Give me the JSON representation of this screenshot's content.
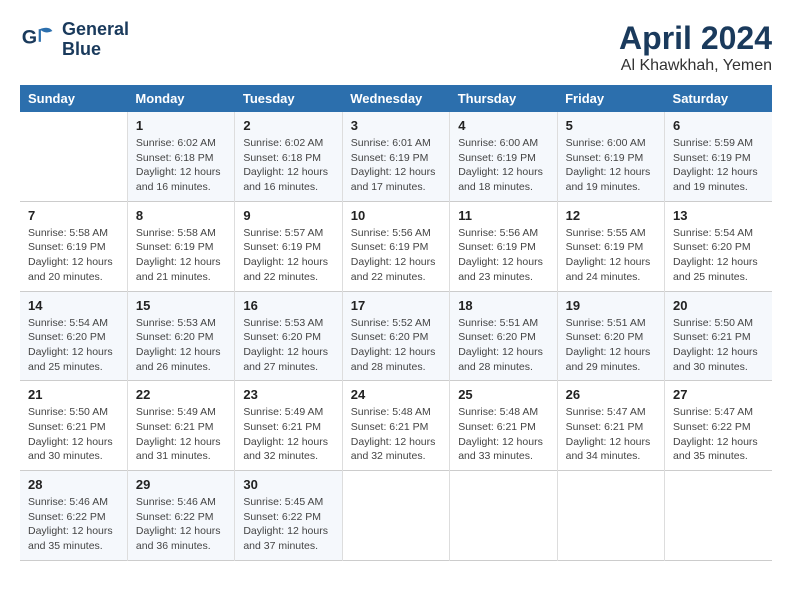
{
  "header": {
    "logo_line1": "General",
    "logo_line2": "Blue",
    "title": "April 2024",
    "subtitle": "Al Khawkhah, Yemen"
  },
  "columns": [
    "Sunday",
    "Monday",
    "Tuesday",
    "Wednesday",
    "Thursday",
    "Friday",
    "Saturday"
  ],
  "weeks": [
    [
      {
        "day": "",
        "info": ""
      },
      {
        "day": "1",
        "info": "Sunrise: 6:02 AM\nSunset: 6:18 PM\nDaylight: 12 hours\nand 16 minutes."
      },
      {
        "day": "2",
        "info": "Sunrise: 6:02 AM\nSunset: 6:18 PM\nDaylight: 12 hours\nand 16 minutes."
      },
      {
        "day": "3",
        "info": "Sunrise: 6:01 AM\nSunset: 6:19 PM\nDaylight: 12 hours\nand 17 minutes."
      },
      {
        "day": "4",
        "info": "Sunrise: 6:00 AM\nSunset: 6:19 PM\nDaylight: 12 hours\nand 18 minutes."
      },
      {
        "day": "5",
        "info": "Sunrise: 6:00 AM\nSunset: 6:19 PM\nDaylight: 12 hours\nand 19 minutes."
      },
      {
        "day": "6",
        "info": "Sunrise: 5:59 AM\nSunset: 6:19 PM\nDaylight: 12 hours\nand 19 minutes."
      }
    ],
    [
      {
        "day": "7",
        "info": "Sunrise: 5:58 AM\nSunset: 6:19 PM\nDaylight: 12 hours\nand 20 minutes."
      },
      {
        "day": "8",
        "info": "Sunrise: 5:58 AM\nSunset: 6:19 PM\nDaylight: 12 hours\nand 21 minutes."
      },
      {
        "day": "9",
        "info": "Sunrise: 5:57 AM\nSunset: 6:19 PM\nDaylight: 12 hours\nand 22 minutes."
      },
      {
        "day": "10",
        "info": "Sunrise: 5:56 AM\nSunset: 6:19 PM\nDaylight: 12 hours\nand 22 minutes."
      },
      {
        "day": "11",
        "info": "Sunrise: 5:56 AM\nSunset: 6:19 PM\nDaylight: 12 hours\nand 23 minutes."
      },
      {
        "day": "12",
        "info": "Sunrise: 5:55 AM\nSunset: 6:19 PM\nDaylight: 12 hours\nand 24 minutes."
      },
      {
        "day": "13",
        "info": "Sunrise: 5:54 AM\nSunset: 6:20 PM\nDaylight: 12 hours\nand 25 minutes."
      }
    ],
    [
      {
        "day": "14",
        "info": "Sunrise: 5:54 AM\nSunset: 6:20 PM\nDaylight: 12 hours\nand 25 minutes."
      },
      {
        "day": "15",
        "info": "Sunrise: 5:53 AM\nSunset: 6:20 PM\nDaylight: 12 hours\nand 26 minutes."
      },
      {
        "day": "16",
        "info": "Sunrise: 5:53 AM\nSunset: 6:20 PM\nDaylight: 12 hours\nand 27 minutes."
      },
      {
        "day": "17",
        "info": "Sunrise: 5:52 AM\nSunset: 6:20 PM\nDaylight: 12 hours\nand 28 minutes."
      },
      {
        "day": "18",
        "info": "Sunrise: 5:51 AM\nSunset: 6:20 PM\nDaylight: 12 hours\nand 28 minutes."
      },
      {
        "day": "19",
        "info": "Sunrise: 5:51 AM\nSunset: 6:20 PM\nDaylight: 12 hours\nand 29 minutes."
      },
      {
        "day": "20",
        "info": "Sunrise: 5:50 AM\nSunset: 6:21 PM\nDaylight: 12 hours\nand 30 minutes."
      }
    ],
    [
      {
        "day": "21",
        "info": "Sunrise: 5:50 AM\nSunset: 6:21 PM\nDaylight: 12 hours\nand 30 minutes."
      },
      {
        "day": "22",
        "info": "Sunrise: 5:49 AM\nSunset: 6:21 PM\nDaylight: 12 hours\nand 31 minutes."
      },
      {
        "day": "23",
        "info": "Sunrise: 5:49 AM\nSunset: 6:21 PM\nDaylight: 12 hours\nand 32 minutes."
      },
      {
        "day": "24",
        "info": "Sunrise: 5:48 AM\nSunset: 6:21 PM\nDaylight: 12 hours\nand 32 minutes."
      },
      {
        "day": "25",
        "info": "Sunrise: 5:48 AM\nSunset: 6:21 PM\nDaylight: 12 hours\nand 33 minutes."
      },
      {
        "day": "26",
        "info": "Sunrise: 5:47 AM\nSunset: 6:21 PM\nDaylight: 12 hours\nand 34 minutes."
      },
      {
        "day": "27",
        "info": "Sunrise: 5:47 AM\nSunset: 6:22 PM\nDaylight: 12 hours\nand 35 minutes."
      }
    ],
    [
      {
        "day": "28",
        "info": "Sunrise: 5:46 AM\nSunset: 6:22 PM\nDaylight: 12 hours\nand 35 minutes."
      },
      {
        "day": "29",
        "info": "Sunrise: 5:46 AM\nSunset: 6:22 PM\nDaylight: 12 hours\nand 36 minutes."
      },
      {
        "day": "30",
        "info": "Sunrise: 5:45 AM\nSunset: 6:22 PM\nDaylight: 12 hours\nand 37 minutes."
      },
      {
        "day": "",
        "info": ""
      },
      {
        "day": "",
        "info": ""
      },
      {
        "day": "",
        "info": ""
      },
      {
        "day": "",
        "info": ""
      }
    ]
  ]
}
